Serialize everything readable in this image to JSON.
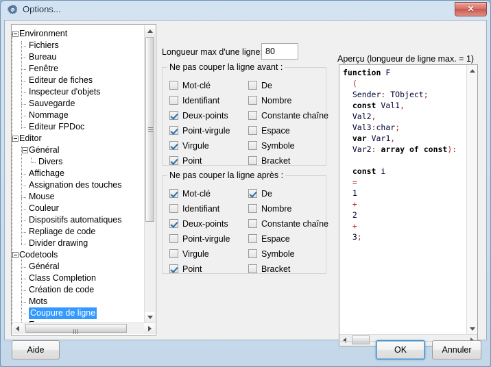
{
  "window": {
    "title": "Options...",
    "icon": "gear-icon",
    "close_label": "✕"
  },
  "tree": {
    "selected": "Coupure de ligne",
    "selection_color": "#3399ff",
    "items": [
      {
        "label": "Environment",
        "depth": 0,
        "expandable": true
      },
      {
        "label": "Fichiers",
        "depth": 1,
        "expandable": false
      },
      {
        "label": "Bureau",
        "depth": 1,
        "expandable": false
      },
      {
        "label": "Fenêtre",
        "depth": 1,
        "expandable": false
      },
      {
        "label": "Editeur de fiches",
        "depth": 1,
        "expandable": false
      },
      {
        "label": "Inspecteur d'objets",
        "depth": 1,
        "expandable": false
      },
      {
        "label": "Sauvegarde",
        "depth": 1,
        "expandable": false
      },
      {
        "label": "Nommage",
        "depth": 1,
        "expandable": false
      },
      {
        "label": "Editeur FPDoc",
        "depth": 1,
        "expandable": false
      },
      {
        "label": "Editor",
        "depth": 0,
        "expandable": true
      },
      {
        "label": "Général",
        "depth": 1,
        "expandable": true
      },
      {
        "label": "Divers",
        "depth": 2,
        "expandable": false
      },
      {
        "label": "Affichage",
        "depth": 1,
        "expandable": false
      },
      {
        "label": "Assignation des touches",
        "depth": 1,
        "expandable": false
      },
      {
        "label": "Mouse",
        "depth": 1,
        "expandable": false
      },
      {
        "label": "Couleur",
        "depth": 1,
        "expandable": false
      },
      {
        "label": "Dispositifs automatiques",
        "depth": 1,
        "expandable": false
      },
      {
        "label": "Repliage de code",
        "depth": 1,
        "expandable": false
      },
      {
        "label": "Divider drawing",
        "depth": 1,
        "expandable": false
      },
      {
        "label": "Codetools",
        "depth": 0,
        "expandable": true
      },
      {
        "label": "Général",
        "depth": 1,
        "expandable": false
      },
      {
        "label": "Class Completion",
        "depth": 1,
        "expandable": false
      },
      {
        "label": "Création de code",
        "depth": 1,
        "expandable": false
      },
      {
        "label": "Mots",
        "depth": 1,
        "expandable": false
      },
      {
        "label": "Coupure de ligne",
        "depth": 1,
        "expandable": false,
        "selected": true
      },
      {
        "label": "Espace",
        "depth": 1,
        "expandable": false
      }
    ]
  },
  "settings": {
    "line_length_label": "Longueur max d'une ligne:",
    "line_length_value": "80",
    "group_before": {
      "title": "Ne pas couper la ligne avant :",
      "left_column": [
        {
          "label": "Mot-clé",
          "checked": false
        },
        {
          "label": "Identifiant",
          "checked": false
        },
        {
          "label": "Deux-points",
          "checked": true
        },
        {
          "label": "Point-virgule",
          "checked": true
        },
        {
          "label": "Virgule",
          "checked": true
        },
        {
          "label": "Point",
          "checked": true
        }
      ],
      "right_column": [
        {
          "label": "De",
          "checked": false
        },
        {
          "label": "Nombre",
          "checked": false
        },
        {
          "label": "Constante chaîne",
          "checked": false
        },
        {
          "label": "Espace",
          "checked": false
        },
        {
          "label": "Symbole",
          "checked": false
        },
        {
          "label": "Bracket",
          "checked": false
        }
      ]
    },
    "group_after": {
      "title": "Ne pas couper la ligne après :",
      "left_column": [
        {
          "label": "Mot-clé",
          "checked": true
        },
        {
          "label": "Identifiant",
          "checked": false
        },
        {
          "label": "Deux-points",
          "checked": true
        },
        {
          "label": "Point-virgule",
          "checked": false
        },
        {
          "label": "Virgule",
          "checked": false
        },
        {
          "label": "Point",
          "checked": true
        }
      ],
      "right_column": [
        {
          "label": "De",
          "checked": true
        },
        {
          "label": "Nombre",
          "checked": false
        },
        {
          "label": "Constante chaîne",
          "checked": false
        },
        {
          "label": "Espace",
          "checked": false
        },
        {
          "label": "Symbole",
          "checked": false
        },
        {
          "label": "Bracket",
          "checked": false
        }
      ]
    }
  },
  "preview": {
    "label": "Aperçu (longueur de ligne max. = 1)",
    "colors": {
      "keyword": "#000000",
      "symbol": "#b22222",
      "identifier": "#000033"
    },
    "lines": [
      [
        {
          "t": "function",
          "c": "kw"
        },
        {
          "t": " F",
          "c": "id"
        }
      ],
      [
        {
          "t": "  ",
          "c": "id"
        },
        {
          "t": "(",
          "c": "sym"
        }
      ],
      [
        {
          "t": "  Sender",
          "c": "id"
        },
        {
          "t": ":",
          "c": "sym"
        },
        {
          "t": " TObject",
          "c": "id"
        },
        {
          "t": ";",
          "c": "sym"
        }
      ],
      [
        {
          "t": "  ",
          "c": "id"
        },
        {
          "t": "const",
          "c": "kw"
        },
        {
          "t": " Val1",
          "c": "id"
        },
        {
          "t": ",",
          "c": "sym"
        }
      ],
      [
        {
          "t": "  Val2",
          "c": "id"
        },
        {
          "t": ",",
          "c": "sym"
        }
      ],
      [
        {
          "t": "  Val3",
          "c": "id"
        },
        {
          "t": ":",
          "c": "sym"
        },
        {
          "t": "char",
          "c": "id"
        },
        {
          "t": ";",
          "c": "sym"
        }
      ],
      [
        {
          "t": "  ",
          "c": "id"
        },
        {
          "t": "var",
          "c": "kw"
        },
        {
          "t": " Var1",
          "c": "id"
        },
        {
          "t": ",",
          "c": "sym"
        }
      ],
      [
        {
          "t": "  Var2",
          "c": "id"
        },
        {
          "t": ":",
          "c": "sym"
        },
        {
          "t": " ",
          "c": "id"
        },
        {
          "t": "array of const",
          "c": "kw"
        },
        {
          "t": ")",
          "c": "sym"
        },
        {
          "t": ":",
          "c": "sym"
        }
      ],
      [
        {
          "t": "",
          "c": "id"
        }
      ],
      [
        {
          "t": "  ",
          "c": "id"
        },
        {
          "t": "const",
          "c": "kw"
        },
        {
          "t": " i",
          "c": "id"
        }
      ],
      [
        {
          "t": "  ",
          "c": "id"
        },
        {
          "t": "=",
          "c": "sym"
        }
      ],
      [
        {
          "t": "  1",
          "c": "num"
        }
      ],
      [
        {
          "t": "  ",
          "c": "id"
        },
        {
          "t": "+",
          "c": "sym"
        }
      ],
      [
        {
          "t": "  2",
          "c": "num"
        }
      ],
      [
        {
          "t": "  ",
          "c": "id"
        },
        {
          "t": "+",
          "c": "sym"
        }
      ],
      [
        {
          "t": "  3",
          "c": "num"
        },
        {
          "t": ";",
          "c": "sym"
        }
      ]
    ]
  },
  "buttons": {
    "help": "Aide",
    "ok": "OK",
    "cancel": "Annuler"
  }
}
